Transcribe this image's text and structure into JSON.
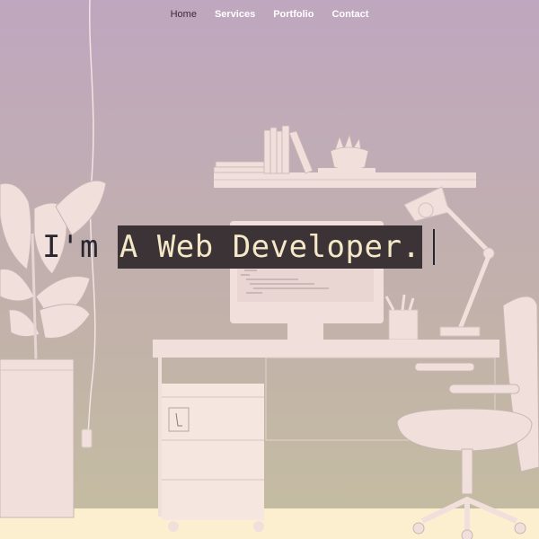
{
  "nav": {
    "items": [
      {
        "label": "Home",
        "active": true
      },
      {
        "label": "Services",
        "active": false
      },
      {
        "label": "Portfolio",
        "active": false
      },
      {
        "label": "Contact",
        "active": false
      }
    ]
  },
  "hero": {
    "static_text": "I'm ",
    "typed_text": "A Web Developer."
  },
  "colors": {
    "gradient_top": "#bfa7bf",
    "gradient_bottom": "#c4bea0",
    "illustration_fill": "#f1dfdc",
    "floor": "#fbefcf",
    "highlight_bg": "#3b3336",
    "highlight_text": "#f5e8c7"
  }
}
